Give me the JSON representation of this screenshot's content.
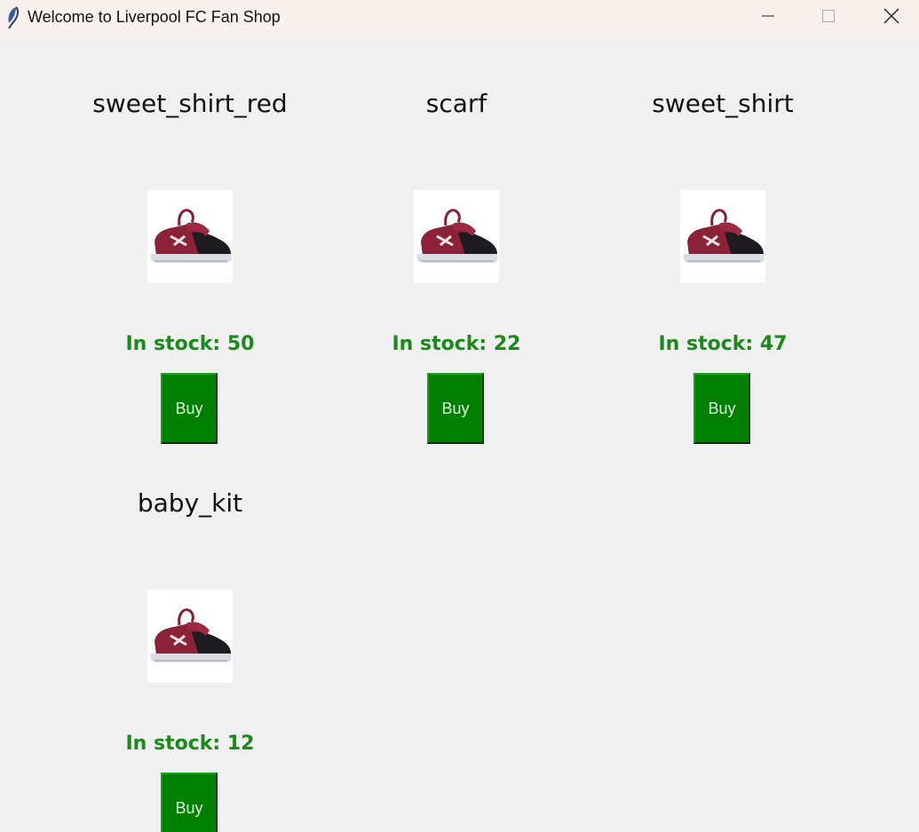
{
  "window": {
    "title": "Welcome to Liverpool FC Fan Shop",
    "app_icon": "feather-icon",
    "controls": [
      "minimize-icon",
      "maximize-icon",
      "close-icon"
    ]
  },
  "colors": {
    "background": "#f0f0f0",
    "titlebar": "#f9f1ee",
    "stock_text": "#1a8a1a",
    "buy_button": "#008000"
  },
  "products": [
    {
      "name": "sweet_shirt_red",
      "stock": "In stock: 50",
      "buy_label": "Buy",
      "image": "sneaker-image"
    },
    {
      "name": "scarf",
      "stock": "In stock: 22",
      "buy_label": "Buy",
      "image": "sneaker-image"
    },
    {
      "name": "sweet_shirt",
      "stock": "In stock: 47",
      "buy_label": "Buy",
      "image": "sneaker-image"
    },
    {
      "name": "baby_kit",
      "stock": "In stock: 12",
      "buy_label": "Buy",
      "image": "sneaker-image"
    }
  ]
}
